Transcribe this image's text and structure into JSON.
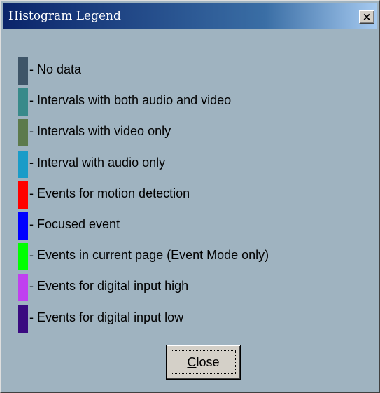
{
  "window": {
    "title": "Histogram Legend",
    "close_glyph": "×"
  },
  "legend": {
    "items": [
      {
        "label": "- No data",
        "color": "#3e5568"
      },
      {
        "label": "- Intervals with both audio and video",
        "color": "#388a8a"
      },
      {
        "label": "- Intervals with video only",
        "color": "#5c7a4c"
      },
      {
        "label": "- Interval with audio only",
        "color": "#1a9cc8"
      },
      {
        "label": "- Events for motion detection",
        "color": "#ff0000"
      },
      {
        "label": "- Focused event",
        "color": "#0000ff"
      },
      {
        "label": "- Events in current page (Event Mode only)",
        "color": "#00ff00"
      },
      {
        "label": "- Events for digital input high",
        "color": "#c040f0"
      },
      {
        "label": "- Events for digital input low",
        "color": "#3a0a80"
      }
    ]
  },
  "buttons": {
    "close_label": "Close",
    "close_mnemonic": "C",
    "close_rest": "lose"
  },
  "colors": {
    "background": "#9fb3c0",
    "titlebar_start": "#0a246a",
    "titlebar_end": "#a6caf0"
  }
}
